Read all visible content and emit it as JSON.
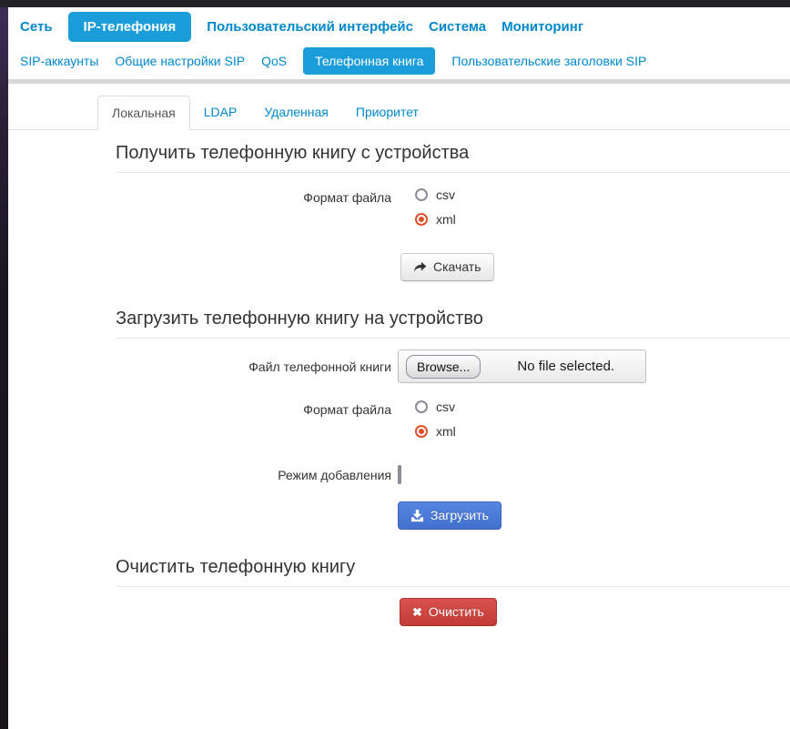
{
  "topnav": {
    "items": [
      {
        "label": "Сеть",
        "active": false
      },
      {
        "label": "IP-телефония",
        "active": true
      },
      {
        "label": "Пользовательский интерфейс",
        "active": false
      },
      {
        "label": "Система",
        "active": false
      },
      {
        "label": "Мониторинг",
        "active": false
      }
    ]
  },
  "subnav": {
    "items": [
      {
        "label": "SIP-аккаунты",
        "active": false
      },
      {
        "label": "Общие настройки SIP",
        "active": false
      },
      {
        "label": "QoS",
        "active": false
      },
      {
        "label": "Телефонная книга",
        "active": true
      },
      {
        "label": "Пользовательские заголовки SIP",
        "active": false
      }
    ]
  },
  "tabs": {
    "items": [
      {
        "label": "Локальная",
        "active": true
      },
      {
        "label": "LDAP",
        "active": false
      },
      {
        "label": "Удаленная",
        "active": false
      },
      {
        "label": "Приоритет",
        "active": false
      }
    ]
  },
  "sections": {
    "download": {
      "title": "Получить телефонную книгу с устройства",
      "format_label": "Формат файла",
      "option_csv": "csv",
      "option_xml": "xml",
      "selected": "xml",
      "button_label": "Скачать"
    },
    "upload": {
      "title": "Загрузить телефонную книгу на устройство",
      "file_label": "Файл телефонной книги",
      "browse_label": "Browse...",
      "no_file_text": "No file selected.",
      "format_label": "Формат файла",
      "option_csv": "csv",
      "option_xml": "xml",
      "selected": "xml",
      "append_label": "Режим добавления",
      "append_checked": false,
      "button_label": "Загрузить"
    },
    "clear": {
      "title": "Очистить телефонную книгу",
      "button_label": "Очистить",
      "button_icon_glyph": "✖"
    }
  },
  "colors": {
    "nav_active_bg": "#1b9dd9",
    "link": "#0088cc",
    "primary_button": "#4a79d5",
    "danger_button": "#c9403a",
    "radio_checked": "#e1502b",
    "divider": "#d8d8d8"
  }
}
